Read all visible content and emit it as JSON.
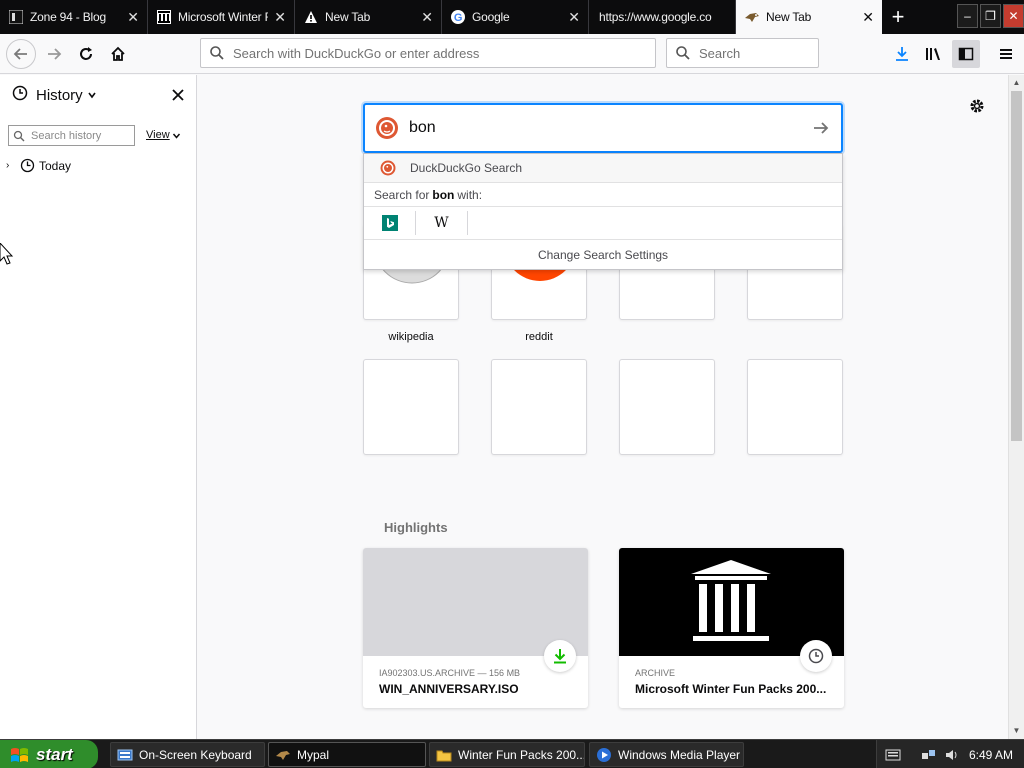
{
  "tabs": [
    {
      "title": "Zone 94 - Blog",
      "icon": "zone94-icon",
      "active": false
    },
    {
      "title": "Microsoft Winter F",
      "icon": "archive-icon",
      "active": false
    },
    {
      "title": "New Tab",
      "icon": "warning-icon",
      "active": false
    },
    {
      "title": "Google",
      "icon": "google-icon",
      "active": false
    },
    {
      "title": "https://www.google.co",
      "icon": "",
      "active": false
    },
    {
      "title": "New Tab",
      "icon": "hawk-icon",
      "active": true
    }
  ],
  "navbar": {
    "url_placeholder": "Search with DuckDuckGo or enter address",
    "search_placeholder": "Search"
  },
  "sidebar": {
    "title": "History",
    "search_placeholder": "Search history",
    "view_label": "View",
    "tree_item": "Today"
  },
  "newtab": {
    "search_query": "bon",
    "suggestions": {
      "engine_label": "DuckDuckGo Search",
      "search_for_prefix": "Search for",
      "search_for_term": "bon",
      "search_for_suffix": "with:",
      "engines": [
        "bing-icon",
        "wikipedia-icon"
      ],
      "change_settings": "Change Search Settings"
    },
    "top_sites": [
      {
        "label": "wikipedia"
      },
      {
        "label": "reddit"
      }
    ],
    "highlights_title": "Highlights",
    "highlights": [
      {
        "meta": "IA902303.US.ARCHIVE — 156 MB",
        "title": "WIN_ANNIVERSARY.ISO",
        "badge": "download-icon"
      },
      {
        "meta": "ARCHIVE",
        "title": "Microsoft Winter Fun Packs 200...",
        "badge": "clock-icon"
      }
    ]
  },
  "taskbar": {
    "start_label": "start",
    "tasks": [
      {
        "label": "On-Screen Keyboard",
        "icon": "keyboard-icon"
      },
      {
        "label": "Mypal",
        "icon": "mypal-icon"
      },
      {
        "label": "Winter Fun Packs 200...",
        "icon": "folder-icon"
      },
      {
        "label": "Windows Media Player",
        "icon": "media-player-icon"
      }
    ],
    "clock": "6:49 AM"
  },
  "colors": {
    "accent": "#0a84ff",
    "tabstrip": "#0c0c0d",
    "start": "#2f8d2b",
    "reddit": "#ff4500",
    "ddg": "#de5833"
  }
}
